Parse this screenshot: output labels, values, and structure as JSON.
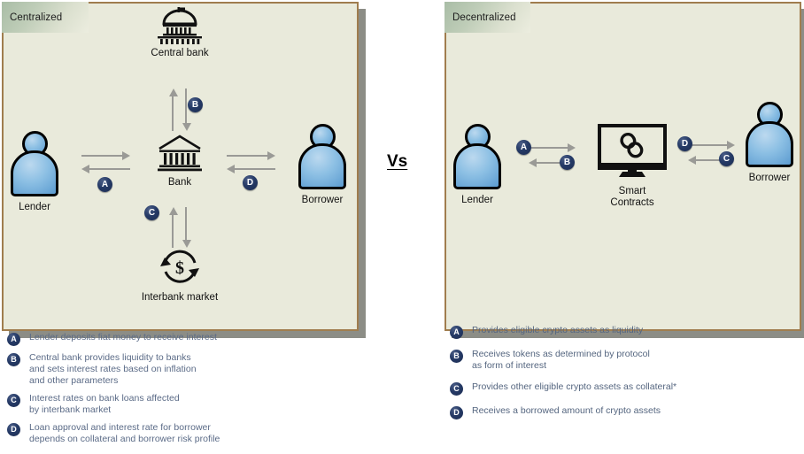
{
  "comparison": {
    "vs_label": "Vs"
  },
  "left": {
    "tab_label": "Centralized",
    "nodes": {
      "central_bank": "Central bank",
      "bank": "Bank",
      "lender": "Lender",
      "borrower": "Borrower",
      "interbank": "Interbank market"
    },
    "badges": {
      "a": "A",
      "b": "B",
      "c": "C",
      "d": "D"
    },
    "legend": [
      {
        "key": "A",
        "text": "Lender deposits fiat money to receive interest"
      },
      {
        "key": "B",
        "text": "Central bank provides liquidity to banks\nand sets interest rates based on inflation\nand other parameters"
      },
      {
        "key": "C",
        "text": "Interest rates on bank loans affected\nby interbank market"
      },
      {
        "key": "D",
        "text": "Loan approval and interest rate for borrower\ndepends on collateral and borrower risk profile"
      }
    ]
  },
  "right": {
    "tab_label": "Decentralized",
    "nodes": {
      "lender": "Lender",
      "borrower": "Borrower",
      "smart_contracts": "Smart\nContracts"
    },
    "badges": {
      "a": "A",
      "b": "B",
      "c": "C",
      "d": "D"
    },
    "legend": [
      {
        "key": "A",
        "text": "Provides eligible crypto assets as liquidity"
      },
      {
        "key": "B",
        "text": "Receives tokens as determined by protocol\nas form of interest"
      },
      {
        "key": "C",
        "text": "Provides other eligible crypto assets as collateral*"
      },
      {
        "key": "D",
        "text": "Receives a borrowed amount of crypto assets"
      }
    ]
  },
  "colors": {
    "panel_bg": "#e9eadb",
    "panel_border": "#a07d4e",
    "panel_shadow": "#8c8d86",
    "badge_navy": "#24386a",
    "arrow_gray": "#9a9a96",
    "person_blue": "#6aa6d8",
    "legend_text": "#5b6b87"
  }
}
